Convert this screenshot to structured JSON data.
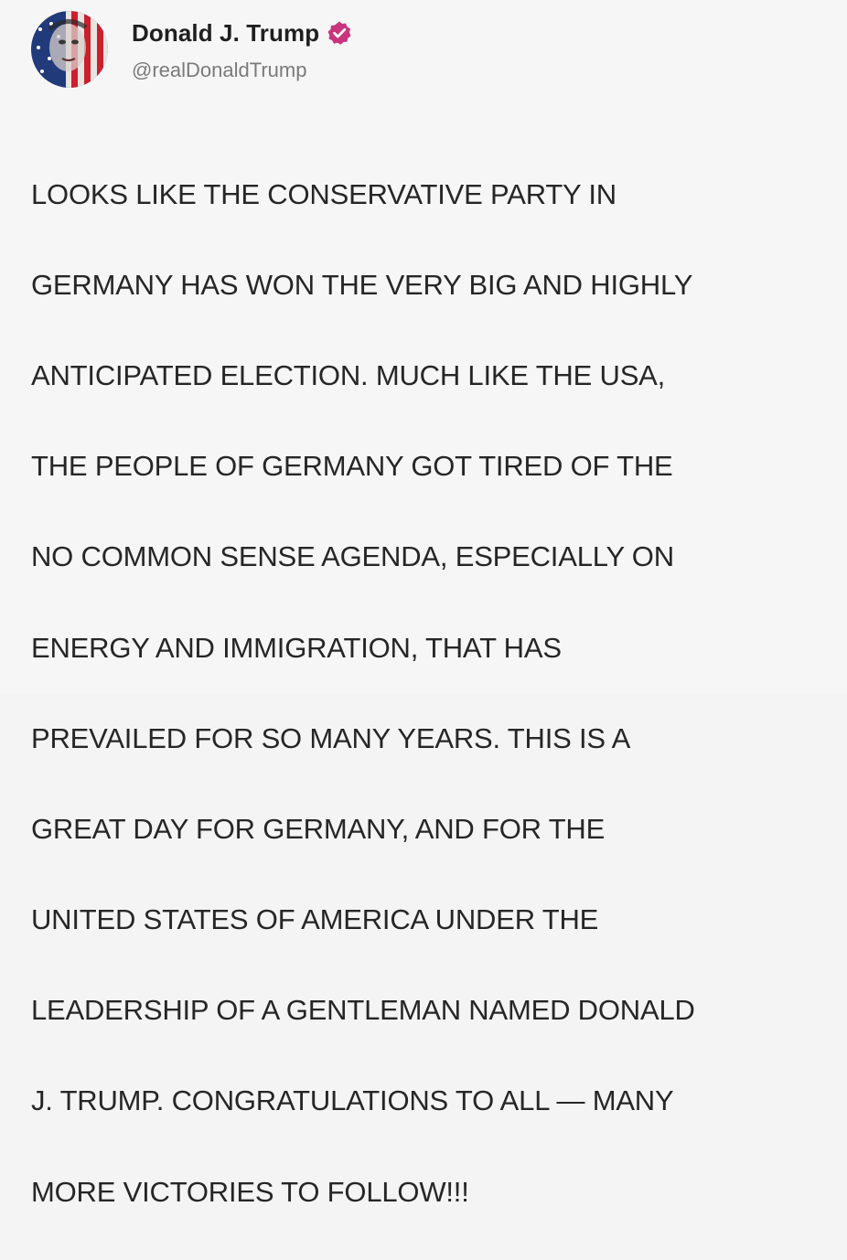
{
  "post": {
    "author": {
      "display_name": "Donald J. Trump",
      "handle": "@realDonaldTrump",
      "verified_icon": "verified-badge-icon",
      "verified_color": "#c8357c"
    },
    "text_lines": [
      "LOOKS LIKE THE CONSERVATIVE PARTY IN",
      "GERMANY HAS WON THE VERY BIG AND HIGHLY",
      "ANTICIPATED ELECTION. MUCH LIKE THE USA,",
      "THE PEOPLE OF GERMANY GOT TIRED OF THE",
      "NO COMMON SENSE AGENDA, ESPECIALLY ON",
      "ENERGY AND IMMIGRATION, THAT HAS",
      "PREVAILED FOR SO MANY YEARS. THIS IS A",
      "GREAT DAY FOR GERMANY, AND FOR THE",
      "UNITED STATES OF AMERICA UNDER THE",
      "LEADERSHIP OF A GENTLEMAN NAMED DONALD",
      "J. TRUMP. CONGRATULATIONS TO ALL — MANY",
      "MORE VICTORIES TO FOLLOW!!!"
    ]
  }
}
